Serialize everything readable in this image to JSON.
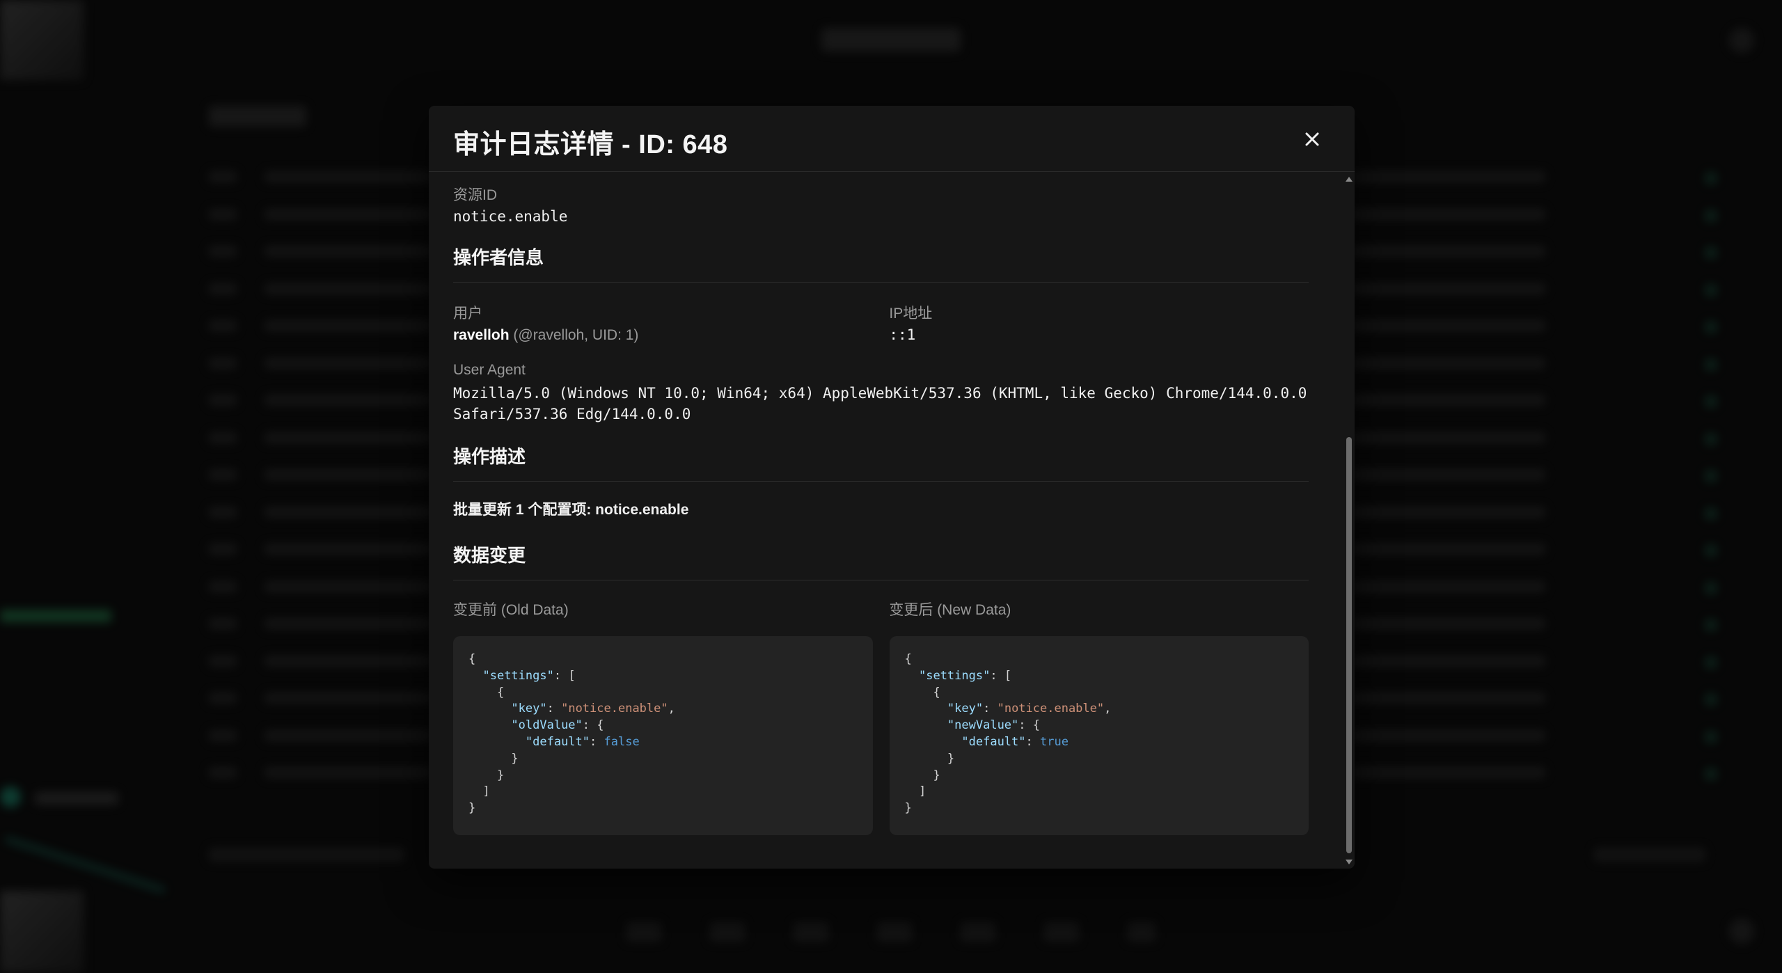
{
  "modal": {
    "title": "审计日志详情 - ID: 648",
    "close_icon": "close-icon"
  },
  "resource": {
    "label": "资源ID",
    "value": "notice.enable"
  },
  "operator": {
    "section_title": "操作者信息",
    "user_label": "用户",
    "user_name": "ravelloh",
    "user_meta": " (@ravelloh, UID: 1)",
    "ip_label": "IP地址",
    "ip_value": "::1",
    "ua_label": "User Agent",
    "ua_value": "Mozilla/5.0 (Windows NT 10.0; Win64; x64) AppleWebKit/537.36 (KHTML, like Gecko) Chrome/144.0.0.0 Safari/537.36 Edg/144.0.0.0"
  },
  "description": {
    "section_title": "操作描述",
    "text": "批量更新 1 个配置项: notice.enable"
  },
  "changes": {
    "section_title": "数据变更",
    "old_label": "变更前 (Old Data)",
    "new_label": "变更后 (New Data)",
    "old": {
      "l_settings_key": "\"settings\"",
      "l_key_key": "\"key\"",
      "l_key_val": "\"notice.enable\"",
      "l_value_key": "\"oldValue\"",
      "l_default_key": "\"default\"",
      "l_default_val": "false"
    },
    "new": {
      "l_settings_key": "\"settings\"",
      "l_key_key": "\"key\"",
      "l_key_val": "\"notice.enable\"",
      "l_value_key": "\"newValue\"",
      "l_default_key": "\"default\"",
      "l_default_val": "true"
    }
  },
  "colors": {
    "modal_bg": "#161616",
    "code_bg": "#232323",
    "json_key": "#9cdcfe",
    "json_string": "#ce9178",
    "json_bool": "#569cd6"
  }
}
